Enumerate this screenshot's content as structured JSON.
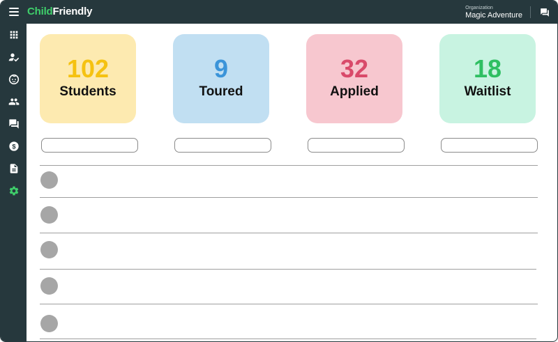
{
  "header": {
    "brand_part1": "Child",
    "brand_part2": "Friendly",
    "org_label": "Organization",
    "org_name": "Magic Adventure"
  },
  "icons": {
    "menu": "hamburger-menu-icon",
    "chat": "chat-icon"
  },
  "sidebar": {
    "items": [
      {
        "icon": "grid-icon"
      },
      {
        "icon": "user-check-icon"
      },
      {
        "icon": "child-face-icon"
      },
      {
        "icon": "people-icon"
      },
      {
        "icon": "messages-icon"
      },
      {
        "icon": "dollar-icon"
      },
      {
        "icon": "document-icon"
      },
      {
        "icon": "settings-icon",
        "active": true
      }
    ]
  },
  "stats": [
    {
      "count": "102",
      "label": "Students",
      "bg": "#fdeab0",
      "color": "#f5c211"
    },
    {
      "count": "9",
      "label": "Toured",
      "bg": "#c1dff2",
      "color": "#3b94d9"
    },
    {
      "count": "32",
      "label": "Applied",
      "bg": "#f7c7cf",
      "color": "#d94a6a"
    },
    {
      "count": "18",
      "label": "Waitlist",
      "bg": "#c8f3e1",
      "color": "#2fbf62"
    }
  ],
  "colors": {
    "topbar": "#26383d",
    "brand_green": "#3fcf6b",
    "active_icon": "#3fcf6b",
    "icon": "#ffffff",
    "avatar_placeholder": "#a6a6a6"
  }
}
